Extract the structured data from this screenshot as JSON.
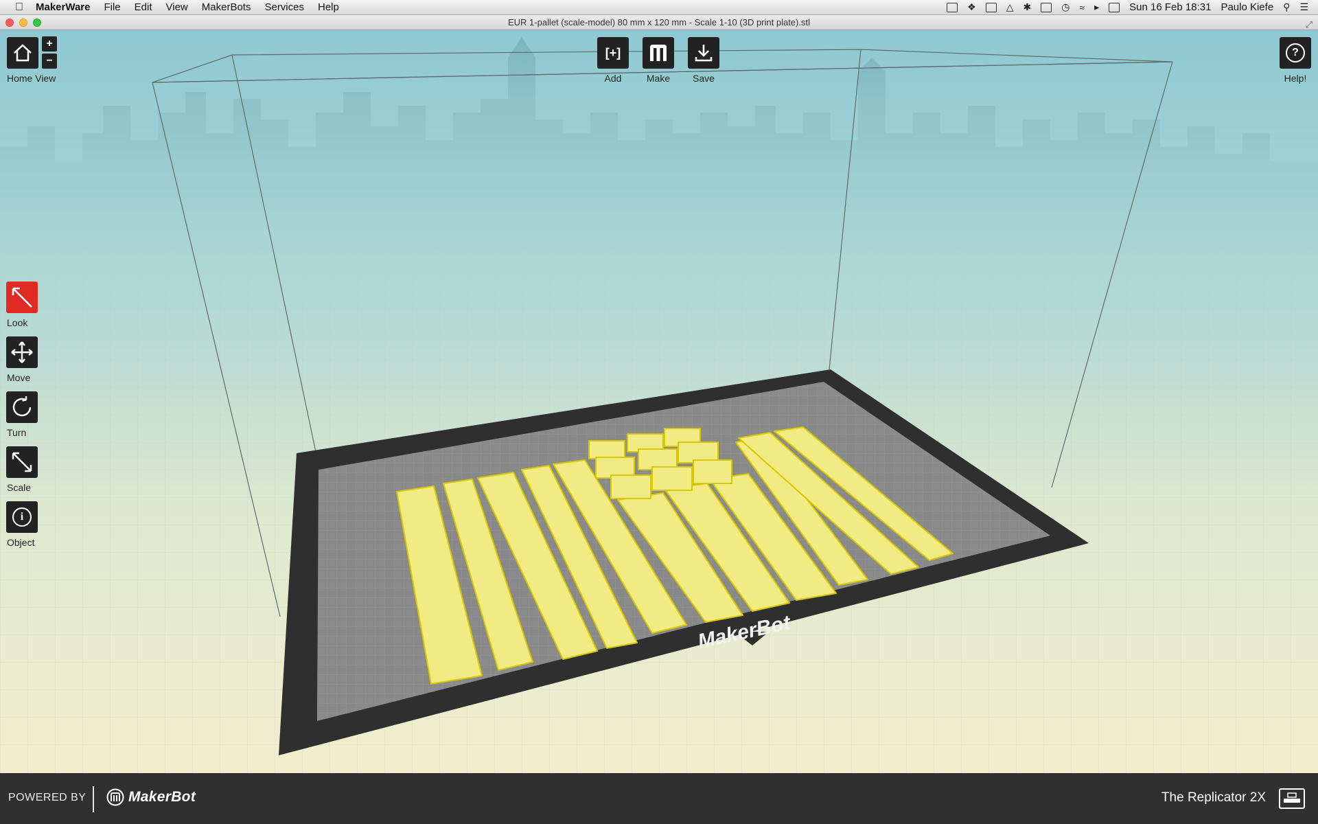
{
  "menubar": {
    "app_name": "MakerWare",
    "items": [
      "File",
      "Edit",
      "View",
      "MakerBots",
      "Services",
      "Help"
    ],
    "datetime": "Sun 16 Feb  18:31",
    "user": "Paulo Kiefe"
  },
  "window": {
    "title": "EUR 1-pallet (scale-model) 80 mm x 120 mm - Scale 1-10 (3D print plate).stl"
  },
  "toolbar": {
    "home_view_label": "Home View",
    "zoom_in_label": "+",
    "zoom_out_label": "−",
    "add_label": "Add",
    "make_label": "Make",
    "save_label": "Save",
    "help_label": "Help!",
    "add_glyph": "[+]",
    "help_glyph": "?"
  },
  "tools": {
    "look_label": "Look",
    "move_label": "Move",
    "turn_label": "Turn",
    "scale_label": "Scale",
    "object_label": "Object",
    "active": "look"
  },
  "plate": {
    "brand_text": "MakerBot"
  },
  "footer": {
    "powered_by": "POWERED BY",
    "brand": "MakerBot",
    "printer_name": "The Replicator 2X"
  },
  "colors": {
    "model_yellow": "#f2ea82",
    "model_edge": "#d8c800",
    "active_tool_red": "#e02a24",
    "plate_dark": "#2f2f2f",
    "plate_grey": "#8a8a8a"
  }
}
